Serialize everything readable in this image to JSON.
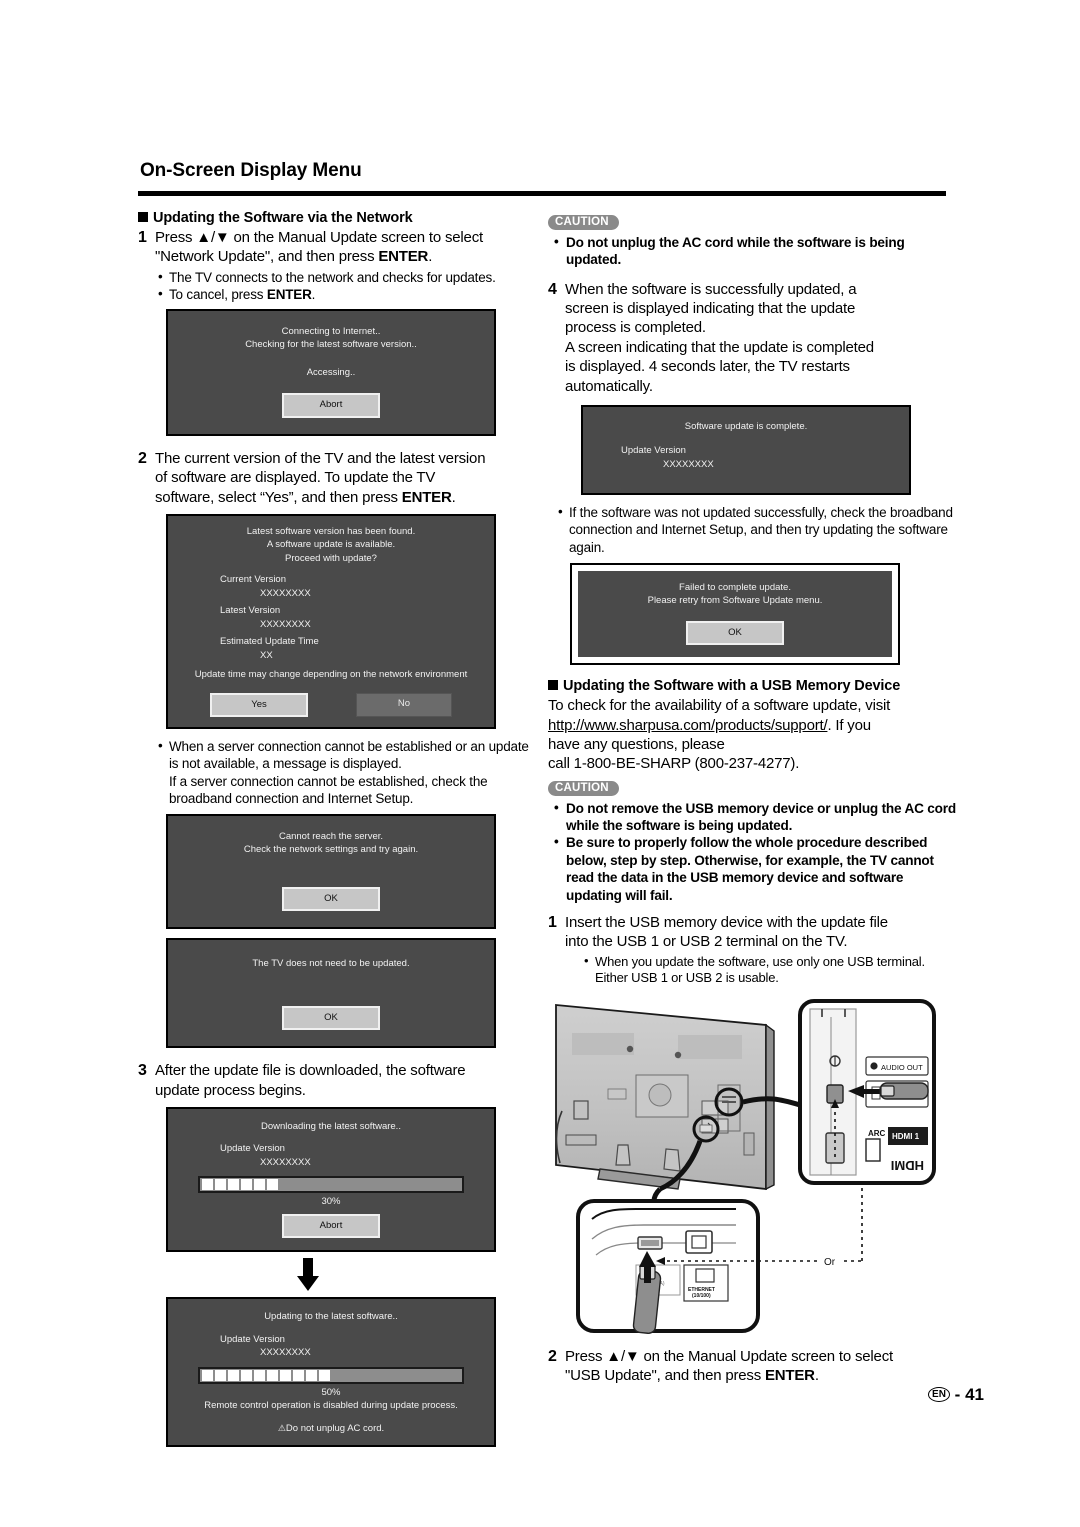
{
  "page": {
    "title": "On-Screen Display Menu",
    "footer_lang": "EN",
    "footer_sep": "-",
    "footer_number": "41"
  },
  "left": {
    "section_heading": "Updating the Software via the Network",
    "step1": {
      "num": "1",
      "line1": "Press ▲/▼ on the Manual Update screen to select",
      "line2_pre": "\"Network Update\", and then press ",
      "line2_kb": "ENTER",
      "line2_post": ".",
      "bullets": [
        "The TV connects to the network and checks for updates.",
        "To cancel, press ENTER."
      ],
      "bullet2_pre": "To cancel, press ",
      "bullet2_kb": "ENTER",
      "bullet2_post": "."
    },
    "osd_connecting": {
      "line1": "Connecting to Internet..",
      "line2": "Checking for the latest software version..",
      "line3": "Accessing..",
      "button": "Abort"
    },
    "step2": {
      "num": "2",
      "line1": "The current version of the TV and the latest version",
      "line2": "of software are displayed. To update the TV",
      "line3_pre": "software, select “Yes”, and then press ",
      "line3_kb": "ENTER",
      "line3_post": "."
    },
    "osd_version": {
      "line1": "Latest software version has been found.",
      "line2": "A software update is available.",
      "line3": "Proceed with update?",
      "current_label": "Current Version",
      "current_value": "XXXXXXXX",
      "latest_label": "Latest Version",
      "latest_value": "XXXXXXXX",
      "time_label": "Estimated Update Time",
      "time_value": "XX",
      "note": "Update time may change depending on the network environment",
      "yes": "Yes",
      "no": "No"
    },
    "note_server": {
      "line1": "When a server connection cannot be established or an",
      "line2": "update is not available, a message is displayed.",
      "line3": "If a server connection cannot be established, check the",
      "line4": "broadband connection and Internet Setup."
    },
    "osd_cannot_reach": {
      "line1": "Cannot reach the server.",
      "line2": "Check the network settings and try again.",
      "button": "OK"
    },
    "osd_no_update": {
      "line1": "The TV does not need to be updated.",
      "button": "OK"
    },
    "step3": {
      "num": "3",
      "line1": "After the update file is downloaded, the software",
      "line2": "update process begins."
    },
    "osd_downloading": {
      "line1": "Downloading the latest software..",
      "version_label": "Update Version",
      "version_value": "XXXXXXXX",
      "percent": "30%",
      "progress": 30,
      "segments": 6,
      "button": "Abort"
    },
    "osd_updating": {
      "line1": "Updating to the latest software..",
      "version_label": "Update Version",
      "version_value": "XXXXXXXX",
      "percent": "50%",
      "progress": 50,
      "segments": 10,
      "note": "Remote control operation is disabled during update process.",
      "warning": "Do not unplug AC cord."
    }
  },
  "right": {
    "caution1": {
      "badge": "CAUTION",
      "items": [
        "Do not unplug the AC cord while the software is being updated."
      ]
    },
    "step4": {
      "num": "4",
      "line1": "When the software is successfully updated, a",
      "line2": "screen is displayed indicating that the update",
      "line3": "process is completed.",
      "line4": "A screen indicating that the update is completed",
      "line5": "is displayed. 4 seconds later, the TV restarts",
      "line6": "automatically."
    },
    "osd_complete": {
      "line1": "Software update is complete.",
      "version_label": "Update Version",
      "version_value": "XXXXXXXX"
    },
    "note_failed": {
      "line1": "If the software was not updated successfully, check the",
      "line2": "broadband connection and Internet Setup, and then try",
      "line3": "updating the software again."
    },
    "osd_failed": {
      "line1": "Failed to complete update.",
      "line2": "Please retry from Software Update menu.",
      "button": "OK"
    },
    "usb_section": {
      "heading": "Updating the Software with a USB Memory Device",
      "line1": "To check for the availability of a software update, visit",
      "url": "http://www.sharpusa.com/products/support/",
      "line2_post": ". If you",
      "line3": "have any questions, please",
      "line4": "call 1-800-BE-SHARP (800-237-4277)."
    },
    "caution2": {
      "badge": "CAUTION",
      "item1": "Do not remove the USB memory device or unplug the AC cord while the software is being updated.",
      "item2": "Be sure to properly follow the whole procedure described below, step by step. Otherwise, for example, the TV cannot read the data in the USB memory device and software updating will fail."
    },
    "usb_step1": {
      "num": "1",
      "line1": "Insert the USB memory device with the update file",
      "line2": "into the USB 1 or USB 2 terminal on the TV.",
      "bullet": "When you update the software, use only one USB terminal. Either USB 1 or USB 2 is usable."
    },
    "illustration": {
      "audio_out": "AUDIO OUT",
      "arc": "ARC",
      "hdmi1": "HDMI 1",
      "hdmi_logo": "HDMI",
      "or": "Or",
      "ethernet": "ETHERNET (10/100)"
    },
    "usb_step2": {
      "num": "2",
      "line1": "Press ▲/▼ on the Manual Update screen to select",
      "line2_pre": "\"USB Update\", and then press ",
      "line2_kb": "ENTER",
      "line2_post": "."
    }
  }
}
